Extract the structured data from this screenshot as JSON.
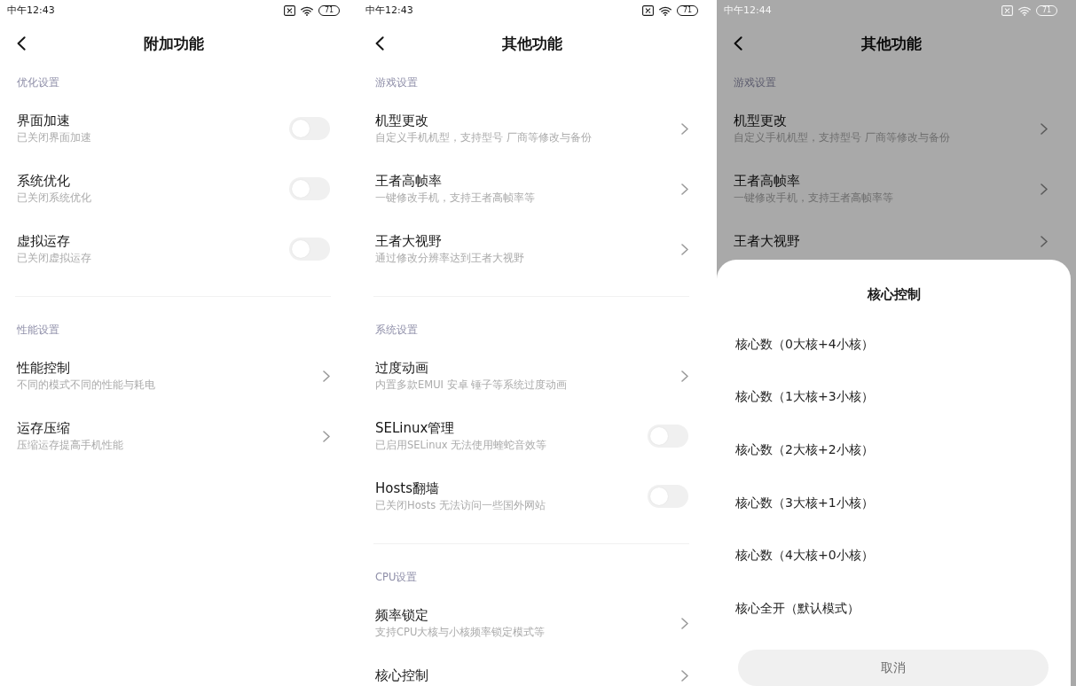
{
  "screens": [
    {
      "status_bar": {
        "time": "中午12:43",
        "battery": "71"
      },
      "title": "附加功能",
      "sections": [
        {
          "title": "优化设置",
          "items": [
            {
              "kind": "toggle",
              "title": "界面加速",
              "subtitle": "已关闭界面加速",
              "on": false
            },
            {
              "kind": "toggle",
              "title": "系统优化",
              "subtitle": "已关闭系统优化",
              "on": false
            },
            {
              "kind": "toggle",
              "title": "虚拟运存",
              "subtitle": "已关闭虚拟运存",
              "on": false
            }
          ]
        },
        {
          "title": "性能设置",
          "items": [
            {
              "kind": "link",
              "title": "性能控制",
              "subtitle": "不同的模式不同的性能与耗电"
            },
            {
              "kind": "link",
              "title": "运存压缩",
              "subtitle": "压缩运存提高手机性能"
            }
          ]
        }
      ]
    },
    {
      "status_bar": {
        "time": "中午12:43",
        "battery": "71"
      },
      "title": "其他功能",
      "sections": [
        {
          "title": "游戏设置",
          "items": [
            {
              "kind": "link",
              "title": "机型更改",
              "subtitle": "自定义手机机型，支持型号 厂商等修改与备份"
            },
            {
              "kind": "link",
              "title": "王者高帧率",
              "subtitle": "一键修改手机，支持王者高帧率等"
            },
            {
              "kind": "link",
              "title": "王者大视野",
              "subtitle": "通过修改分辨率达到王者大视野"
            }
          ]
        },
        {
          "title": "系统设置",
          "items": [
            {
              "kind": "link",
              "title": "过度动画",
              "subtitle": "内置多款EMUI 安卓 锤子等系统过度动画"
            },
            {
              "kind": "toggle",
              "title": "SELinux管理",
              "subtitle": "已启用SELinux 无法使用蝰蛇音效等",
              "on": false
            },
            {
              "kind": "toggle",
              "title": "Hosts翻墙",
              "subtitle": "已关闭Hosts 无法访问一些国外网站",
              "on": false
            }
          ]
        },
        {
          "title": "CPU设置",
          "items": [
            {
              "kind": "link",
              "title": "频率锁定",
              "subtitle": "支持CPU大核与小核频率锁定模式等"
            },
            {
              "kind": "link",
              "title": "核心控制"
            }
          ]
        }
      ]
    },
    {
      "status_bar": {
        "time": "中午12:44",
        "battery": "71"
      },
      "title": "其他功能",
      "sections": [
        {
          "title": "游戏设置",
          "items": [
            {
              "kind": "link",
              "title": "机型更改",
              "subtitle": "自定义手机机型，支持型号 厂商等修改与备份"
            },
            {
              "kind": "link",
              "title": "王者高帧率",
              "subtitle": "一键修改手机，支持王者高帧率等"
            },
            {
              "kind": "link",
              "title": "王者大视野"
            }
          ]
        }
      ],
      "sheet": {
        "title": "核心控制",
        "options": [
          "核心数（0大核+4小核）",
          "核心数（1大核+3小核）",
          "核心数（2大核+2小核）",
          "核心数（3大核+1小核）",
          "核心数（4大核+0小核）",
          "核心全开（默认模式）"
        ],
        "cancel": "取消"
      }
    }
  ]
}
